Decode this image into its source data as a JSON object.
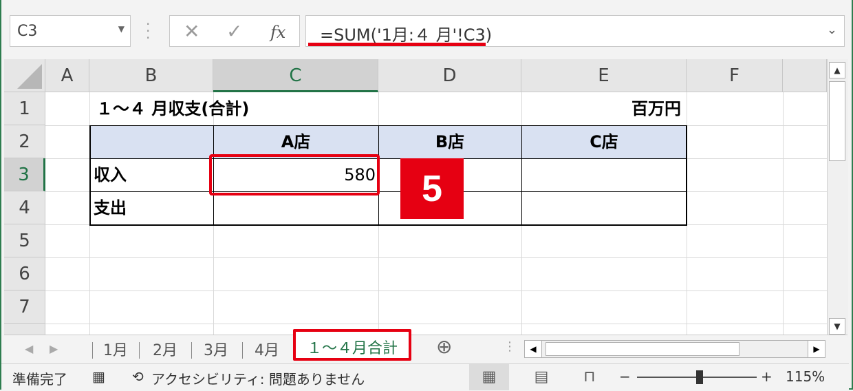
{
  "name_box": {
    "value": "C3"
  },
  "formula_bar": {
    "cancel_icon": "✕",
    "enter_icon": "✓",
    "fx_label": "fx",
    "formula": "=SUM('1月:４ 月'!C3)"
  },
  "columns": [
    "A",
    "B",
    "C",
    "D",
    "E",
    "F"
  ],
  "rows": [
    "1",
    "2",
    "3",
    "4",
    "5",
    "6",
    "7"
  ],
  "cells": {
    "B1": "１～４ 月収支(合計)",
    "E1": "百万円",
    "C2": "A店",
    "D2": "B店",
    "E2": "C店",
    "B3": "収入",
    "C3": "580",
    "B4": "支出"
  },
  "badge": "5",
  "sheet_tabs": [
    {
      "label": "1月"
    },
    {
      "label": "2月"
    },
    {
      "label": "3月"
    },
    {
      "label": "4月"
    },
    {
      "label": "１～４月合計",
      "active": true
    }
  ],
  "add_sheet_icon": "⊕",
  "status_bar": {
    "ready": "準備完了",
    "accessibility": "アクセシビリティ: 問題ありません",
    "zoom": "115%",
    "zoom_minus": "−",
    "zoom_plus": "+"
  },
  "colors": {
    "accent_green": "#217346",
    "highlight_red": "#e60012",
    "header_blue": "#d9e1f2"
  }
}
